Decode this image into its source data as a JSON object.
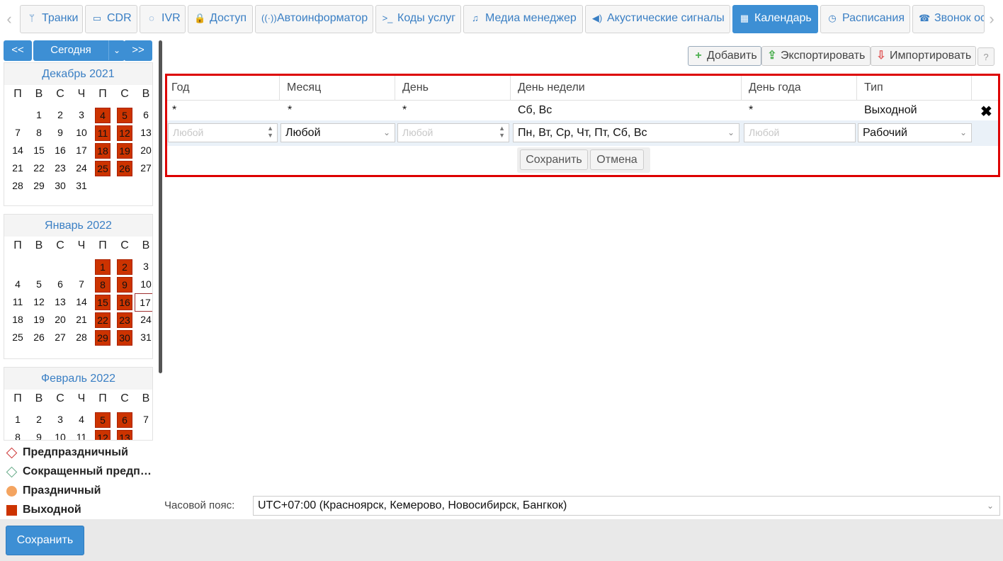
{
  "tabs": [
    {
      "label": "Транки",
      "icon": "trunk-icon",
      "glyph": "ᛘ"
    },
    {
      "label": "CDR",
      "icon": "credit-card-icon",
      "glyph": "▭"
    },
    {
      "label": "IVR",
      "icon": "chat-icon",
      "glyph": "◌"
    },
    {
      "label": "Доступ",
      "icon": "lock-icon",
      "glyph": "🔒"
    },
    {
      "label": "Автоинформатор",
      "icon": "broadcast-icon",
      "glyph": "((·))"
    },
    {
      "label": "Коды услуг",
      "icon": "terminal-icon",
      "glyph": ">_"
    },
    {
      "label": "Медиа менеджер",
      "icon": "music-icon",
      "glyph": "♫"
    },
    {
      "label": "Акустические сигналы",
      "icon": "volume-icon",
      "glyph": "◀)"
    },
    {
      "label": "Календарь",
      "icon": "calendar-icon",
      "glyph": "▦",
      "active": true
    },
    {
      "label": "Расписания",
      "icon": "clock-icon",
      "glyph": "◷"
    },
    {
      "label": "Звонок ос",
      "icon": "phone-icon",
      "glyph": "☎"
    }
  ],
  "calendar_nav": {
    "prev": "<<",
    "today": "Сегодня",
    "next": ">>"
  },
  "day_names": [
    "П",
    "В",
    "С",
    "Ч",
    "П",
    "С",
    "В"
  ],
  "months": [
    {
      "title": "Декабрь 2021",
      "start": 2,
      "days": 31,
      "off": [
        4,
        5,
        11,
        12,
        18,
        19,
        25,
        26
      ]
    },
    {
      "title": "Январь 2022",
      "start": 5,
      "days": 31,
      "off": [
        1,
        2,
        8,
        9,
        15,
        16,
        22,
        23,
        29,
        30
      ],
      "today": 17
    },
    {
      "title": "Февраль 2022",
      "start": 1,
      "days": 13,
      "off": [
        5,
        6,
        12,
        13
      ]
    }
  ],
  "legend": [
    {
      "label": "Предпраздничный",
      "shape": "diamond",
      "color": "#cc3333"
    },
    {
      "label": "Сокращенный предп…",
      "shape": "diamond",
      "color": "#66aa88"
    },
    {
      "label": "Праздничный",
      "shape": "circle",
      "color": "#f4a460"
    },
    {
      "label": "Выходной",
      "shape": "square",
      "color": "#cc3300"
    }
  ],
  "toolbar": {
    "add": "Добавить",
    "export": "Экспортировать",
    "import": "Импортировать",
    "help": "?"
  },
  "table": {
    "headers": [
      "Год",
      "Месяц",
      "День",
      "День недели",
      "День года",
      "Тип"
    ],
    "row": [
      "*",
      "*",
      "*",
      "Сб, Вс",
      "*",
      "Выходной"
    ],
    "edit": {
      "year_placeholder": "Любой",
      "month": "Любой",
      "day_placeholder": "Любой",
      "weekdays": "Пн, Вт, Ср, Чт, Пт, Сб, Вс",
      "yearday_placeholder": "Любой",
      "type": "Рабочий"
    },
    "save": "Сохранить",
    "cancel": "Отмена"
  },
  "timezone": {
    "label": "Часовой пояс:",
    "value": "UTC+07:00 (Красноярск, Кемерово, Новосибирск, Бангкок)"
  },
  "save_button": "Сохранить"
}
